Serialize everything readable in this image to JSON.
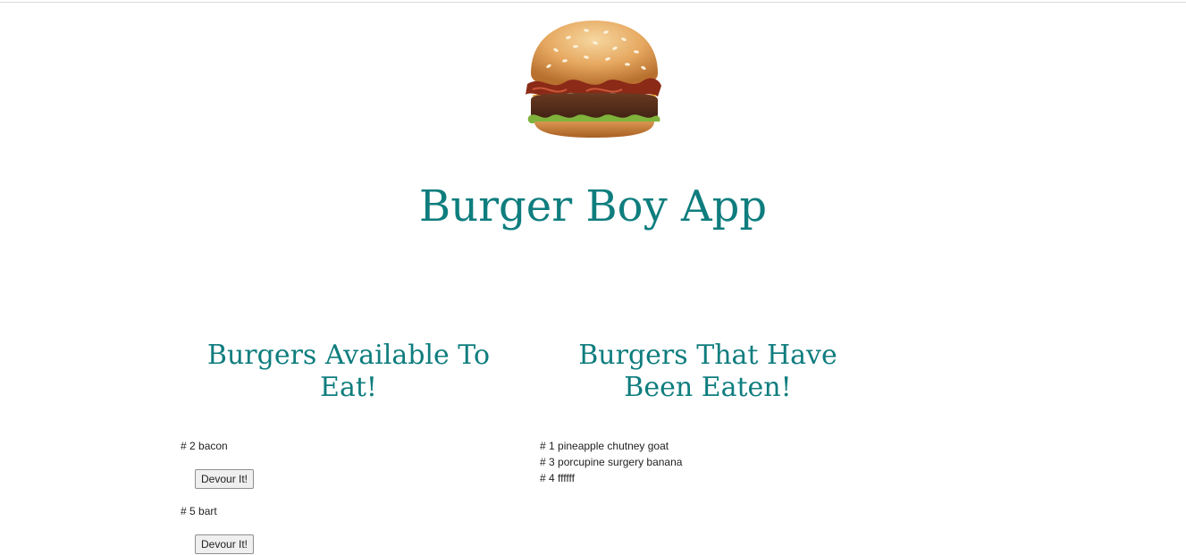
{
  "header": {
    "title": "Burger Boy App"
  },
  "available": {
    "heading": "Burgers Available To Eat!",
    "items": [
      {
        "label": "# 2 bacon",
        "button_label": "Devour It!"
      },
      {
        "label": "# 5 bart",
        "button_label": "Devour It!"
      }
    ]
  },
  "eaten": {
    "heading": "Burgers That Have Been Eaten!",
    "items": [
      {
        "label": "# 1 pineapple chutney goat"
      },
      {
        "label": "# 3 porcupine surgery banana"
      },
      {
        "label": "# 4 ffffff"
      }
    ]
  },
  "colors": {
    "accent": "#0f7d7e"
  },
  "icons": {
    "logo": "hamburger-logo"
  }
}
